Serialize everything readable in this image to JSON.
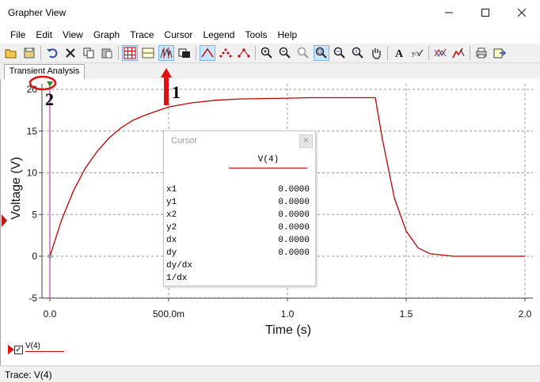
{
  "window": {
    "title": "Grapher View"
  },
  "menu": [
    "File",
    "Edit",
    "View",
    "Graph",
    "Trace",
    "Cursor",
    "Legend",
    "Tools",
    "Help"
  ],
  "toolbar": {
    "buttons": [
      {
        "icon": "open-folder-icon"
      },
      {
        "icon": "save-disk-icon"
      },
      {
        "icon": "undo-icon"
      },
      {
        "icon": "delete-x-icon"
      },
      {
        "icon": "copy-icon"
      },
      {
        "icon": "paste-icon"
      },
      {
        "icon": "grid-icon"
      },
      {
        "icon": "split-panel-icon"
      },
      {
        "icon": "cursor-toggle-icon"
      },
      {
        "icon": "overlay-icon"
      },
      {
        "icon": "peak-icon"
      },
      {
        "icon": "points-icon"
      },
      {
        "icon": "line-points-icon"
      },
      {
        "icon": "zoom-in-icon"
      },
      {
        "icon": "zoom-out-icon"
      },
      {
        "icon": "zoom-extent-icon"
      },
      {
        "icon": "zoom-area-icon"
      },
      {
        "icon": "zoom-x-icon"
      },
      {
        "icon": "zoom-y-icon"
      },
      {
        "icon": "pan-hand-icon"
      },
      {
        "icon": "text-a-icon"
      },
      {
        "icon": "text-format-icon"
      },
      {
        "icon": "cross-trace-icon"
      },
      {
        "icon": "trace-style-icon"
      },
      {
        "icon": "print-icon"
      },
      {
        "icon": "export-icon"
      }
    ],
    "highlight_color": "#cce4f7"
  },
  "tabs": [
    {
      "label": "Transient Analysis",
      "active": true
    }
  ],
  "graph": {
    "trace_color": "#c00000",
    "cursor_color": "#cc33cc"
  },
  "chart_data": {
    "type": "line",
    "xlabel": "Time (s)",
    "ylabel": "Voltage (V)",
    "xlim": [
      -0.02,
      2.0
    ],
    "ylim": [
      -5.7,
      21.2
    ],
    "xticks": [
      0.0,
      0.5,
      1.0,
      1.5,
      2.0
    ],
    "xtick_labels": [
      "0.0",
      "500.0m",
      "1.0",
      "1.5",
      "2.0"
    ],
    "yticks": [
      -5,
      0,
      5,
      10,
      15,
      20
    ],
    "ytick_labels": [
      "-5",
      "0",
      "5",
      "10",
      "15",
      "20"
    ],
    "grid": true,
    "series": [
      {
        "name": "V(4)",
        "x": [
          0.0,
          0.05,
          0.1,
          0.15,
          0.2,
          0.25,
          0.3,
          0.35,
          0.4,
          0.45,
          0.5,
          0.6,
          0.7,
          0.8,
          0.9,
          1.0,
          1.1,
          1.2,
          1.3,
          1.35,
          1.37,
          1.4,
          1.45,
          1.5,
          1.55,
          1.6,
          1.7,
          1.8,
          2.0
        ],
        "y": [
          0.0,
          4.4,
          7.9,
          10.6,
          12.6,
          14.2,
          15.4,
          16.3,
          16.9,
          17.4,
          17.9,
          18.4,
          18.7,
          18.85,
          18.9,
          18.95,
          19.0,
          19.0,
          19.0,
          19.0,
          19.0,
          14.0,
          7.0,
          3.0,
          1.0,
          0.3,
          0.0,
          0.0,
          0.0
        ]
      }
    ],
    "cursor_x": 0.0
  },
  "cursor_panel": {
    "title": "Cursor",
    "column": "V(4)",
    "rows": [
      {
        "label": "x1",
        "value": "0.0000"
      },
      {
        "label": "y1",
        "value": "0.0000"
      },
      {
        "label": "x2",
        "value": "0.0000"
      },
      {
        "label": "y2",
        "value": "0.0000"
      },
      {
        "label": "dx",
        "value": "0.0000"
      },
      {
        "label": "dy",
        "value": "0.0000"
      },
      {
        "label": "dy/dx",
        "value": ""
      },
      {
        "label": "1/dx",
        "value": ""
      }
    ]
  },
  "annotations": {
    "one": "1",
    "two": "2"
  },
  "legend": {
    "label": "V(4)",
    "checked": "✓"
  },
  "status": {
    "text": "Trace: V(4)"
  }
}
